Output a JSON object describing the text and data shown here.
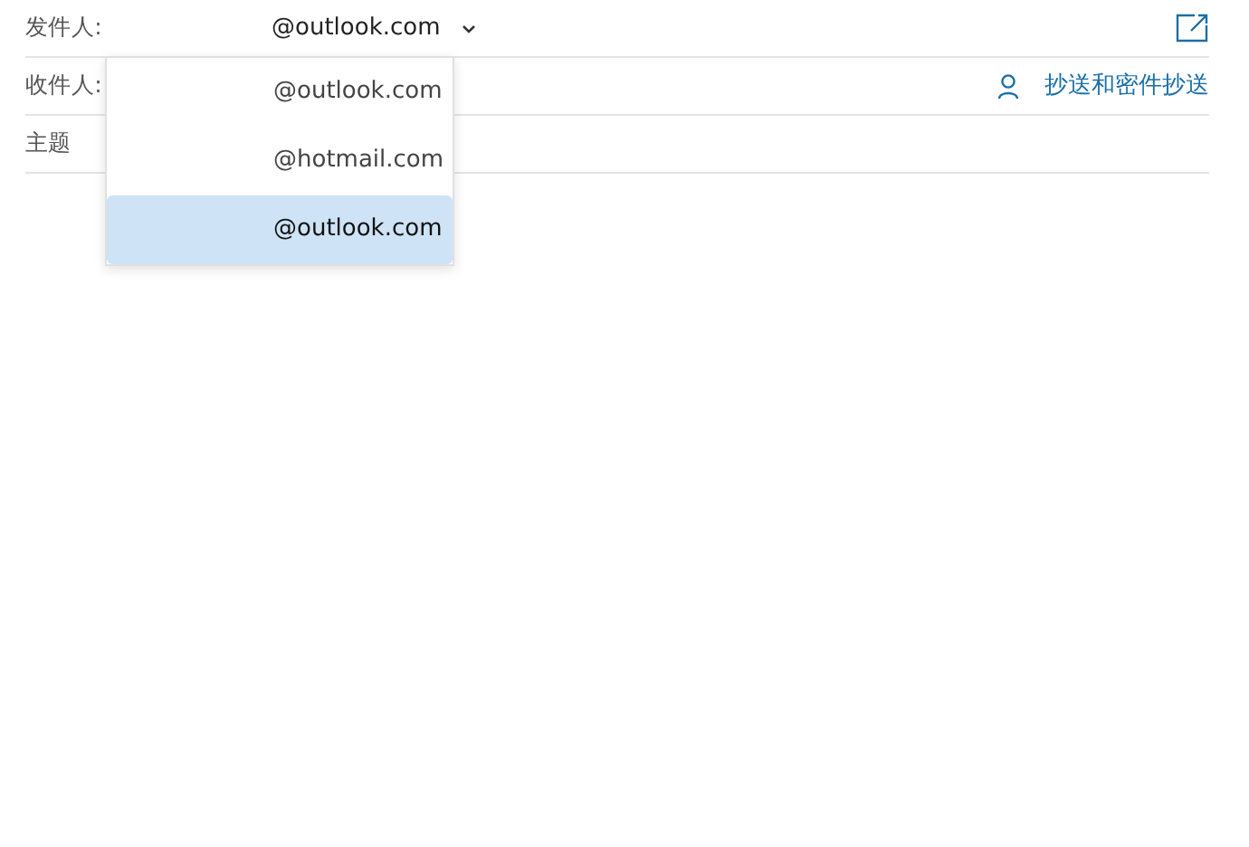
{
  "from": {
    "label": "发件人:",
    "value": "@outlook.com",
    "expanded": true
  },
  "to": {
    "label": "收件人:"
  },
  "cc_bcc": {
    "label": "抄送和密件抄送"
  },
  "subject": {
    "label": "主题"
  },
  "accounts": [
    {
      "address": "@outlook.com",
      "selected": false
    },
    {
      "address": "@hotmail.com",
      "selected": false
    },
    {
      "address": "@outlook.com",
      "selected": true
    }
  ]
}
